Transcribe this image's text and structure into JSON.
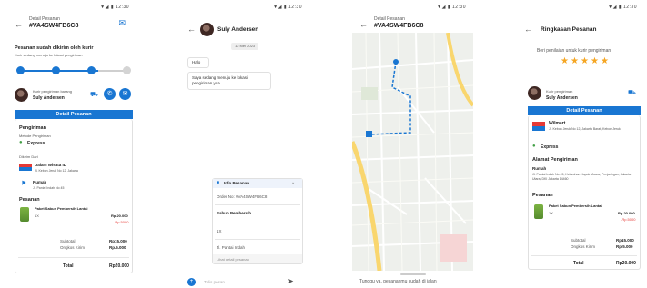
{
  "screen1": {
    "status_time": "▼◢ ▮ 12:30",
    "header": {
      "subtitle": "Detail Pesanan",
      "order_id": "#VA4SW4FB6C8"
    },
    "status_title": "Pesanan sudah dikirim oleh kurir",
    "status_desc": "Kurir sedang menuju ke lokasi pengiriman",
    "courier": {
      "role": "Kurir pengiriman barang",
      "name": "Suly Andersen"
    },
    "detail_button": "Detail Pesanan",
    "shipping": {
      "section": "Pengiriman",
      "method_label": "Metode Pengiriman",
      "method": "Express",
      "from_label": "Dikirim Dari",
      "from_name": "Dalam Wisata ID",
      "from_address": "Jl. Kebon Jeruk No 12, Jakarta",
      "to_name": "Rumah",
      "to_address": "Jl. Pantai Indah No 45"
    },
    "order": {
      "section": "Pesanan",
      "item_name": "Paket Sabun Pembersih Lantai",
      "qty": "1X",
      "price": "Rp.20.000",
      "discount": "-Rp.5000"
    },
    "summary": {
      "subtotal_label": "Subtotal",
      "subtotal_value": "Rp15.000",
      "shipping_label": "Ongkos Kirim",
      "shipping_value": "Rp.5.000",
      "total_label": "Total",
      "total_value": "Rp20.000"
    }
  },
  "screen2": {
    "status_time": "▼◢ ▮ 12:30",
    "contact_name": "Suly Andersen",
    "date_chip": "12 Mei 2023",
    "msg1": "Halo",
    "msg2": "Saya sedang menuju ke lokasi pengiriman yaa",
    "card": {
      "title": "Info Pesanan",
      "order_row": "Order No: #VA4SW4FB6C8",
      "item": "Sabun Pembersih",
      "qty": "1X",
      "address": "Jl. Pantai Indah",
      "footer": "Lihat detail pesanan"
    },
    "input_placeholder": "Tulis pesan"
  },
  "screen3": {
    "status_time": "▼◢ ▮ 12:30",
    "header": {
      "subtitle": "Detail Pesanan",
      "order_id": "#VA4SW4FB6C8"
    },
    "bottom_text": "Tunggu ya, pesananmu sudah di jalan"
  },
  "screen4": {
    "status_time": "▼◢ ▮ 12:30",
    "title": "Ringkasan Pesanan",
    "rating_prompt": "Beri penilaian untuk kurir pengiriman",
    "rating": 5,
    "courier": {
      "role": "Kurir pengiriman",
      "name": "Suly Andersen"
    },
    "detail_button": "Detail Pesanan",
    "store": {
      "name": "Wilmart",
      "address": "Jl. Kebon Jeruk No 12, Jakarta Barat, Kebon Jeruk"
    },
    "method": "Express",
    "address_section": "Alamat Pengiriman",
    "address_label": "Rumah",
    "address_text": "Jl. Pantai Indah No 45, Kelurahan Kapuk Muara, Penjaringan, Jakarta Utara, DKI Jakarta 14460",
    "order_section": "Pesanan",
    "item_name": "Paket Sabun Pembersih Lantai",
    "qty": "1X",
    "price": "Rp.20.000",
    "discount": "-Rp.5000",
    "subtotal_label": "Subtotal",
    "subtotal_value": "Rp15.000",
    "shipping_label": "Ongkos Kirim",
    "shipping_value": "Rp.5.000",
    "total_label": "Total",
    "total_value": "Rp20.000"
  },
  "colors": {
    "primary": "#1976d2",
    "discount": "#e53935",
    "express": "#43a047",
    "star": "#f5a623"
  }
}
